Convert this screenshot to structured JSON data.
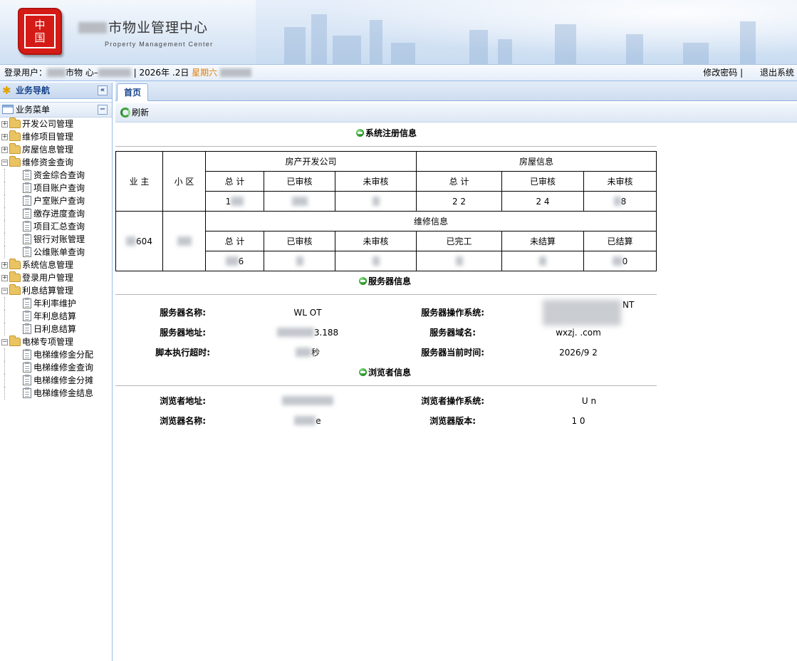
{
  "header": {
    "logo_chars": [
      "中",
      "国"
    ],
    "title": "市物业管理中心",
    "subtitle": "Property  Management Center"
  },
  "statusbar": {
    "login_label": "登录用户：",
    "user_text": "市物   心–",
    "date_text": "| 2026年   .2日",
    "weekday": "星期六",
    "change_password": "修改密码",
    "separator": "|",
    "logout": "退出系统"
  },
  "sidebar": {
    "panel_title": "业务导航",
    "collapse_glyph": "«",
    "menu_title": "业务菜单",
    "menu_toggle": "−",
    "items": [
      {
        "label": "开发公司管理",
        "level": 0,
        "expanded": false
      },
      {
        "label": "维修项目管理",
        "level": 0,
        "expanded": false
      },
      {
        "label": "房屋信息管理",
        "level": 0,
        "expanded": false
      },
      {
        "label": "维修资金查询",
        "level": 0,
        "expanded": true
      },
      {
        "label": "资金综合查询",
        "level": 1
      },
      {
        "label": "项目账户查询",
        "level": 1
      },
      {
        "label": "户室账户查询",
        "level": 1
      },
      {
        "label": "缴存进度查询",
        "level": 1
      },
      {
        "label": "项目汇总查询",
        "level": 1
      },
      {
        "label": "银行对账管理",
        "level": 1
      },
      {
        "label": "公维账单查询",
        "level": 1
      },
      {
        "label": "系统信息管理",
        "level": 0,
        "expanded": false
      },
      {
        "label": "登录用户管理",
        "level": 0,
        "expanded": false
      },
      {
        "label": "利息结算管理",
        "level": 0,
        "expanded": true
      },
      {
        "label": "年利率维护",
        "level": 1
      },
      {
        "label": "年利息结算",
        "level": 1
      },
      {
        "label": "日利息结算",
        "level": 1
      },
      {
        "label": "电梯专项管理",
        "level": 0,
        "expanded": true
      },
      {
        "label": "电梯维修金分配",
        "level": 1
      },
      {
        "label": "电梯维修金查询",
        "level": 1
      },
      {
        "label": "电梯维修金分摊",
        "level": 1
      },
      {
        "label": "电梯维修金结息",
        "level": 1
      }
    ]
  },
  "tabs": [
    {
      "label": "首页"
    }
  ],
  "toolbar": {
    "refresh_label": "刷新"
  },
  "registration": {
    "title": "系统注册信息",
    "owner_header": "业  主",
    "community_header": "小  区",
    "developer_group": "房产开发公司",
    "house_group": "房屋信息",
    "repair_group": "维修信息",
    "total": "总  计",
    "audited": "已审核",
    "unaudited": "未审核",
    "completed": "已完工",
    "unsettled": "未结算",
    "settled": "已结算",
    "owner_value": "604",
    "dev_values": [
      "1",
      "",
      ""
    ],
    "house_values": [
      "2   2",
      "2   4",
      "8"
    ],
    "repair_values": [
      "6",
      "",
      "",
      "",
      "",
      "0"
    ]
  },
  "server": {
    "title": "服务器信息",
    "name_label": "服务器名称:",
    "name_value": "WL    OT",
    "os_label": "服务器操作系统:",
    "os_value": "NT",
    "addr_label": "服务器地址:",
    "addr_value": "3.188",
    "domain_label": "服务器域名:",
    "domain_value": "wxzj.      .com",
    "timeout_label": "脚本执行超时:",
    "timeout_value": "秒",
    "time_label": "服务器当前时间:",
    "time_value": "2026/9      2"
  },
  "browser": {
    "title": "浏览者信息",
    "addr_label": "浏览者地址:",
    "addr_value": "",
    "os_label": "浏览者操作系统:",
    "os_value": "U      n",
    "name_label": "浏览器名称:",
    "name_value": "e",
    "version_label": "浏览器版本:",
    "version_value": "1   0"
  }
}
